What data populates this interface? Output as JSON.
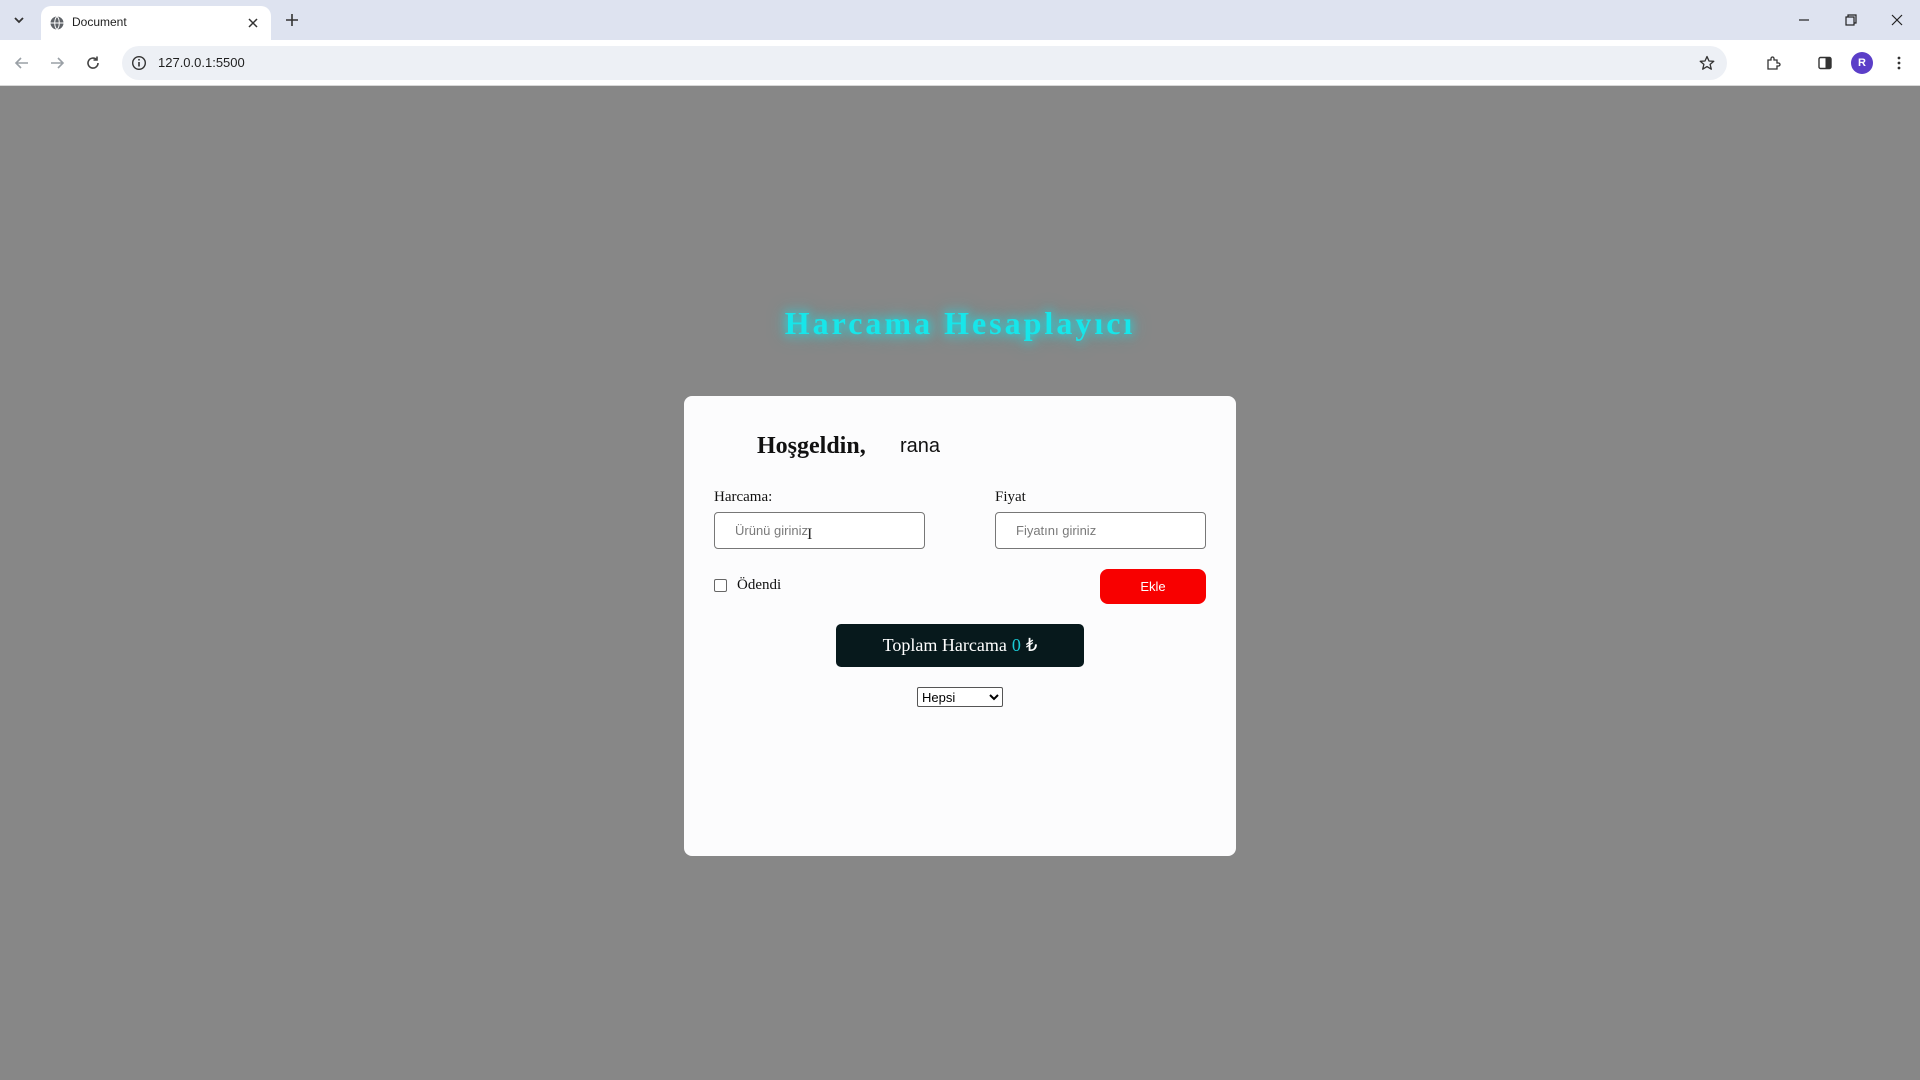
{
  "browser": {
    "tab_title": "Document",
    "url": "127.0.0.1:5500",
    "profile_initial": "R"
  },
  "page": {
    "title": "Harcama Hesaplayıcı",
    "welcome": "Hoşgeldin,",
    "username": "rana",
    "form": {
      "harcama_label": "Harcama:",
      "harcama_placeholder": "Ürünü giriniz",
      "fiyat_label": "Fiyat",
      "fiyat_placeholder": "Fiyatını giriniz",
      "paid_label": "Ödendi",
      "add_button": "Ekle"
    },
    "total": {
      "label": "Toplam Harcama",
      "amount": "0",
      "currency": "₺"
    },
    "filter": {
      "selected": "Hepsi"
    }
  },
  "colors": {
    "page_bg": "#878787",
    "title": "#17e6ea",
    "add_button": "#f80000",
    "total_bg": "#07191c",
    "total_amount": "#19c9d4"
  }
}
